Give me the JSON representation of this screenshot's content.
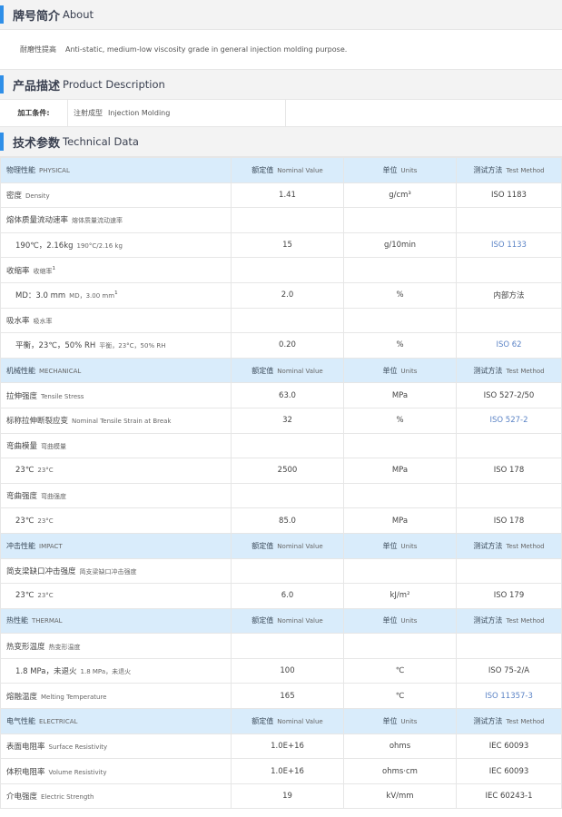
{
  "about": {
    "title_cn": "牌号简介",
    "title_en": "About",
    "key": "耐磨性提高",
    "value": "Anti-static, medium-low viscosity grade in general injection molding purpose."
  },
  "product": {
    "title_cn": "产品描述",
    "title_en": "Product Description",
    "key": "加工条件:",
    "value_cn": "注射成型",
    "value_en": "Injection Molding"
  },
  "tech": {
    "title_cn": "技术参数",
    "title_en": "Technical Data",
    "rows": [
      {
        "type": "group",
        "c0": "物理性能",
        "c0en": "PHYSICAL",
        "c1": "额定值",
        "c1en": "Nominal Value",
        "c2": "单位",
        "c2en": "Units",
        "c3": "测试方法",
        "c3en": "Test Method"
      },
      {
        "type": "row",
        "c0": "密度",
        "c0en": "Density",
        "c1": "1.41",
        "c2": "g/cm³",
        "c3": "ISO 1183",
        "link": false
      },
      {
        "type": "row",
        "c0": "熔体质量流动速率",
        "c0en": "熔体质量流动速率",
        "c1": "",
        "c2": "",
        "c3": "",
        "link": false
      },
      {
        "type": "sub",
        "c0": "190℃，2.16kg",
        "c0en": "190°C/2.16 kg",
        "c1": "15",
        "c2": "g/10min",
        "c3": "ISO 1133",
        "link": true
      },
      {
        "type": "row",
        "c0": "收缩率",
        "c0en": "收缩率",
        "sup": "1",
        "c1": "",
        "c2": "",
        "c3": "",
        "link": false
      },
      {
        "type": "sub",
        "c0": "MD：3.0 mm",
        "c0en": "MD，3.00 mm",
        "sup": "1",
        "c1": "2.0",
        "c2": "%",
        "c3": "内部方法",
        "link": false
      },
      {
        "type": "row",
        "c0": "吸水率",
        "c0en": "吸水率",
        "c1": "",
        "c2": "",
        "c3": "",
        "link": false
      },
      {
        "type": "sub",
        "c0": "平衡，23℃，50% RH",
        "c0en": "平衡，23°C，50% RH",
        "c1": "0.20",
        "c2": "%",
        "c3": "ISO 62",
        "link": true
      },
      {
        "type": "group",
        "c0": "机械性能",
        "c0en": "MECHANICAL",
        "c1": "额定值",
        "c1en": "Nominal Value",
        "c2": "单位",
        "c2en": "Units",
        "c3": "测试方法",
        "c3en": "Test Method"
      },
      {
        "type": "row",
        "c0": "拉伸强度",
        "c0en": "Tensile Stress",
        "c1": "63.0",
        "c2": "MPa",
        "c3": "ISO 527-2/50",
        "link": false
      },
      {
        "type": "row",
        "c0": "标称拉伸断裂应变",
        "c0en": "Nominal Tensile Strain at Break",
        "c1": "32",
        "c2": "%",
        "c3": "ISO 527-2",
        "link": true
      },
      {
        "type": "row",
        "c0": "弯曲模量",
        "c0en": "弯曲模量",
        "c1": "",
        "c2": "",
        "c3": "",
        "link": false
      },
      {
        "type": "sub",
        "c0": "23℃",
        "c0en": "23°C",
        "c1": "2500",
        "c2": "MPa",
        "c3": "ISO 178",
        "link": false
      },
      {
        "type": "row",
        "c0": "弯曲强度",
        "c0en": "弯曲强度",
        "c1": "",
        "c2": "",
        "c3": "",
        "link": false
      },
      {
        "type": "sub",
        "c0": "23℃",
        "c0en": "23°C",
        "c1": "85.0",
        "c2": "MPa",
        "c3": "ISO 178",
        "link": false
      },
      {
        "type": "group",
        "c0": "冲击性能",
        "c0en": "IMPACT",
        "c1": "额定值",
        "c1en": "Nominal Value",
        "c2": "单位",
        "c2en": "Units",
        "c3": "测试方法",
        "c3en": "Test Method"
      },
      {
        "type": "row",
        "c0": "简支梁缺口冲击强度",
        "c0en": "简支梁缺口冲击强度",
        "c1": "",
        "c2": "",
        "c3": "",
        "link": false
      },
      {
        "type": "sub",
        "c0": "23℃",
        "c0en": "23°C",
        "c1": "6.0",
        "c2": "kJ/m²",
        "c3": "ISO 179",
        "link": false
      },
      {
        "type": "group",
        "c0": "热性能",
        "c0en": "THERMAL",
        "c1": "额定值",
        "c1en": "Nominal Value",
        "c2": "单位",
        "c2en": "Units",
        "c3": "测试方法",
        "c3en": "Test Method"
      },
      {
        "type": "row",
        "c0": "热变形温度",
        "c0en": "热变形温度",
        "c1": "",
        "c2": "",
        "c3": "",
        "link": false
      },
      {
        "type": "sub",
        "c0": "1.8 MPa，未退火",
        "c0en": "1.8 MPa，未退火",
        "c1": "100",
        "c2": "℃",
        "c3": "ISO 75-2/A",
        "link": false
      },
      {
        "type": "row",
        "c0": "熔融温度",
        "c0en": "Melting Temperature",
        "c1": "165",
        "c2": "℃",
        "c3": "ISO 11357-3",
        "link": true
      },
      {
        "type": "group",
        "c0": "电气性能",
        "c0en": "ELECTRICAL",
        "c1": "额定值",
        "c1en": "Nominal Value",
        "c2": "单位",
        "c2en": "Units",
        "c3": "测试方法",
        "c3en": "Test Method"
      },
      {
        "type": "row",
        "c0": "表面电阻率",
        "c0en": "Surface Resistivity",
        "c1": "1.0E+16",
        "c2": "ohms",
        "c3": "IEC 60093",
        "link": false
      },
      {
        "type": "row",
        "c0": "体积电阻率",
        "c0en": "Volume Resistivity",
        "c1": "1.0E+16",
        "c2": "ohms·cm",
        "c3": "IEC 60093",
        "link": false
      },
      {
        "type": "row",
        "c0": "介电强度",
        "c0en": "Electric Strength",
        "c1": "19",
        "c2": "kV/mm",
        "c3": "IEC 60243-1",
        "link": false
      }
    ]
  },
  "colors": {
    "accent": "#2f8fe8",
    "group_bg": "#d9ecfb",
    "link": "#5c84c6"
  }
}
